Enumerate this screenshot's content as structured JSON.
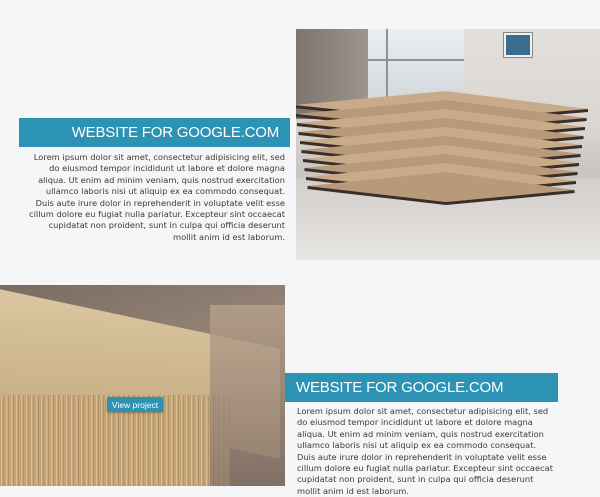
{
  "projects": [
    {
      "title": "WEBSITE FOR GOOGLE.COM",
      "description": "Lorem ipsum dolor sit amet, consectetur adipisicing elit, sed do eiusmod tempor incididunt ut labore et dolore magna aliqua. Ut enim ad minim veniam, quis nostrud exercitation ullamco laboris nisi ut aliquip ex ea commodo consequat. Duis aute irure dolor in reprehenderit in voluptate velit esse cillum dolore eu fugiat nulla pariatur. Excepteur sint occaecat cupidatat non proident, sunt in culpa qui officia deserunt mollit anim id est laborum."
    },
    {
      "title": "WEBSITE FOR GOOGLE.COM",
      "description": "Lorem ipsum dolor sit amet, consectetur adipisicing elit, sed do eiusmod tempor incididunt ut labore et dolore magna aliqua. Ut enim ad minim veniam, quis nostrud exercitation ullamco laboris nisi ut aliquip ex ea commodo consequat. Duis aute irure dolor in reprehenderit in voluptate velit esse cillum dolore eu fugiat nulla pariatur. Excepteur sint occaecat cupidatat non proident, sunt in culpa qui officia deserunt mollit anim id est laborum.",
      "button_label": "View project"
    }
  ],
  "colors": {
    "accent": "#2c93b5",
    "background": "#f5f6f8",
    "text": "#3a3a3a"
  }
}
